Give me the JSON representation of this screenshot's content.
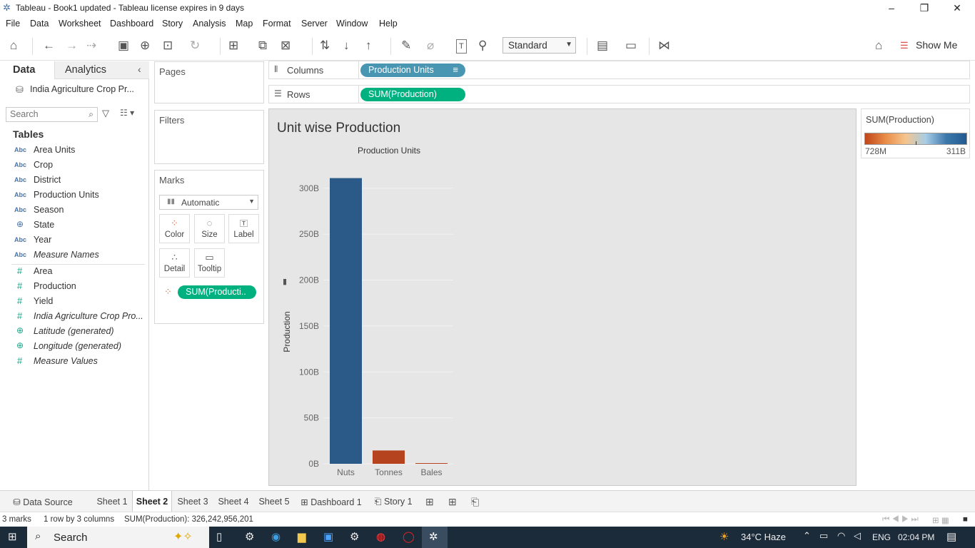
{
  "window": {
    "title": "Tableau - Book1 updated - Tableau license expires in 9 days"
  },
  "menu": [
    "File",
    "Data",
    "Worksheet",
    "Dashboard",
    "Story",
    "Analysis",
    "Map",
    "Format",
    "Server",
    "Window",
    "Help"
  ],
  "toolbar": {
    "standard_label": "Standard",
    "show_me": "Show Me"
  },
  "left_panel": {
    "tab_data": "Data",
    "tab_analytics": "Analytics",
    "datasource": "India Agriculture Crop Pr...",
    "search_placeholder": "Search",
    "tables_heading": "Tables",
    "dimensions": [
      {
        "type": "Abc",
        "name": "Area Units",
        "italic": false
      },
      {
        "type": "Abc",
        "name": "Crop",
        "italic": false
      },
      {
        "type": "Abc",
        "name": "District",
        "italic": false
      },
      {
        "type": "Abc",
        "name": "Production Units",
        "italic": false
      },
      {
        "type": "Abc",
        "name": "Season",
        "italic": false
      },
      {
        "type": "geo",
        "name": "State",
        "italic": false
      },
      {
        "type": "Abc",
        "name": "Year",
        "italic": false
      },
      {
        "type": "Abc",
        "name": "Measure Names",
        "italic": true
      }
    ],
    "measures": [
      {
        "type": "#",
        "name": "Area",
        "italic": false
      },
      {
        "type": "#",
        "name": "Production",
        "italic": false
      },
      {
        "type": "#",
        "name": "Yield",
        "italic": false
      },
      {
        "type": "#",
        "name": "India Agriculture Crop Pro...",
        "italic": true
      },
      {
        "type": "geo",
        "name": "Latitude (generated)",
        "italic": true
      },
      {
        "type": "geo",
        "name": "Longitude (generated)",
        "italic": true
      },
      {
        "type": "#",
        "name": "Measure Values",
        "italic": true
      }
    ]
  },
  "shelves": {
    "pages": "Pages",
    "filters": "Filters",
    "marks": "Marks",
    "mark_type": "Automatic",
    "mark_buttons": [
      "Color",
      "Size",
      "Label",
      "Detail",
      "Tooltip"
    ],
    "marks_pill": "SUM(Producti..",
    "columns_label": "Columns",
    "rows_label": "Rows",
    "columns_pill": "Production Units",
    "rows_pill": "SUM(Production)"
  },
  "legend": {
    "title": "SUM(Production)",
    "min_label": "728M",
    "max_label": "311B",
    "colors": [
      "#c0461a",
      "#e88c47",
      "#f5c58e",
      "#a7cde6",
      "#3d78ab",
      "#225a8e"
    ]
  },
  "chart_data": {
    "type": "bar",
    "title": "Unit wise Production",
    "x_header": "Production Units",
    "ylabel": "Production",
    "categories": [
      "Nuts",
      "Tonnes",
      "Bales"
    ],
    "values": [
      311000000000,
      14500000000,
      728000000
    ],
    "colors": [
      "#2b5a89",
      "#b4431e",
      "#b4431e"
    ],
    "ylim": [
      0,
      320000000000
    ],
    "yticks": [
      0,
      50000000000,
      100000000000,
      150000000000,
      200000000000,
      250000000000,
      300000000000
    ],
    "ytick_labels": [
      "0B",
      "50B",
      "100B",
      "150B",
      "200B",
      "250B",
      "300B"
    ],
    "grid": true
  },
  "tabs": [
    "Data Source",
    "Sheet 1",
    "Sheet 2",
    "Sheet 3",
    "Sheet 4",
    "Sheet 5",
    "Dashboard 1",
    "Story 1"
  ],
  "active_tab": "Sheet 2",
  "status": {
    "marks": "3 marks",
    "rows": "1 row by 3 columns",
    "sum": "SUM(Production): 326,242,956,201"
  },
  "taskbar": {
    "search": "Search",
    "weather": "34°C  Haze",
    "lang": "ENG",
    "time": "02:04 PM"
  }
}
